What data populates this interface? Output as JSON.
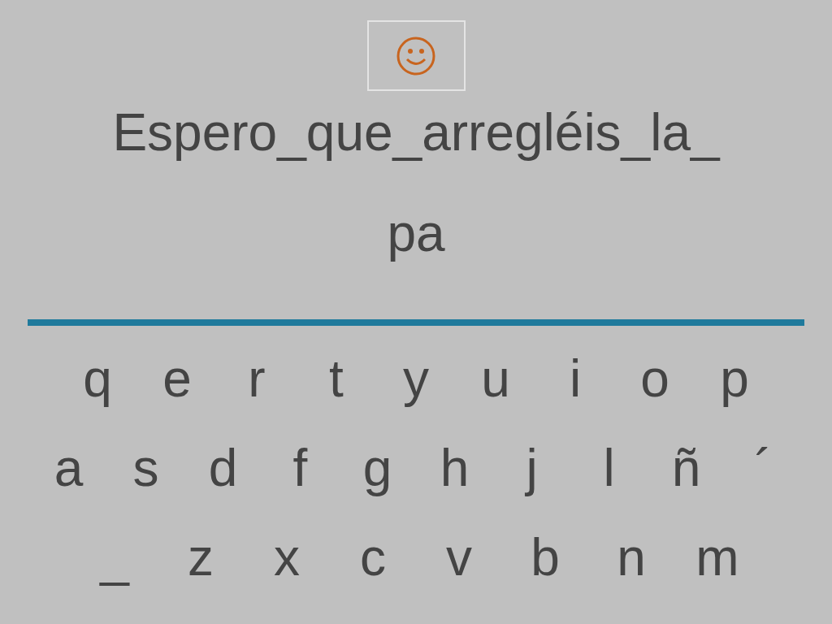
{
  "sentence_lines": [
    "Espero_que_arregléis_la_",
    "pa"
  ],
  "keyboard_rows": [
    [
      "q",
      "e",
      "r",
      "t",
      "y",
      "u",
      "i",
      "o",
      "p"
    ],
    [
      "a",
      "s",
      "d",
      "f",
      "g",
      "h",
      "j",
      "l",
      "ñ",
      "´"
    ],
    [
      "_",
      "z",
      "x",
      "c",
      "v",
      "b",
      "n",
      "m"
    ]
  ]
}
